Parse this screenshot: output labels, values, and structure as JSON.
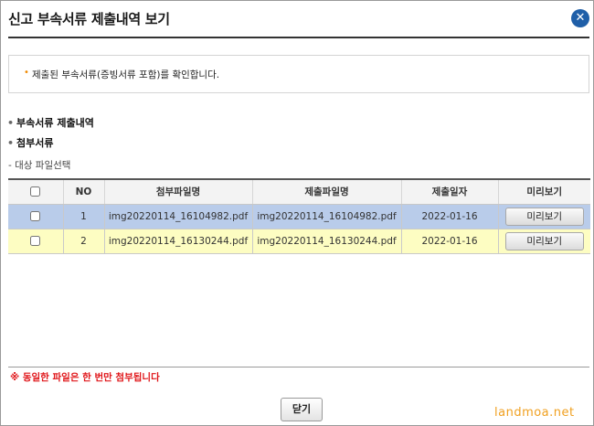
{
  "dialog": {
    "title": "신고 부속서류 제출내역 보기",
    "close_icon": "✕",
    "notice_bullet": "•",
    "notice_text": "제출된 부속서류(증빙서류 포함)를 확인합니다."
  },
  "sections": {
    "bullet": "•",
    "attachments_history": "부속서류 제출내역",
    "attached_docs": "첨부서류",
    "file_select": "- 대상 파일선택"
  },
  "table": {
    "headers": {
      "no": "NO",
      "attached_name": "첨부파일명",
      "submitted_name": "제출파일명",
      "date": "제출일자",
      "preview": "미리보기"
    },
    "rows": [
      {
        "no": "1",
        "attached_name": "img20220114_16104982.pdf",
        "submitted_name": "img20220114_16104982.pdf",
        "date": "2022-01-16",
        "preview_label": "미리보기",
        "checked": false
      },
      {
        "no": "2",
        "attached_name": "img20220114_16130244.pdf",
        "submitted_name": "img20220114_16130244.pdf",
        "date": "2022-01-16",
        "preview_label": "미리보기",
        "checked": false
      }
    ]
  },
  "footer": {
    "warning": "※ 동일한 파일은 한 번만 첨부됩니다",
    "close_label": "닫기"
  },
  "watermark": "landmoa.net",
  "colors": {
    "accent": "#1f5fa8",
    "warning": "#e0161a",
    "row_selected": "#b9ccea",
    "row_highlight": "#fdfdc2",
    "watermark": "#f0a020"
  }
}
